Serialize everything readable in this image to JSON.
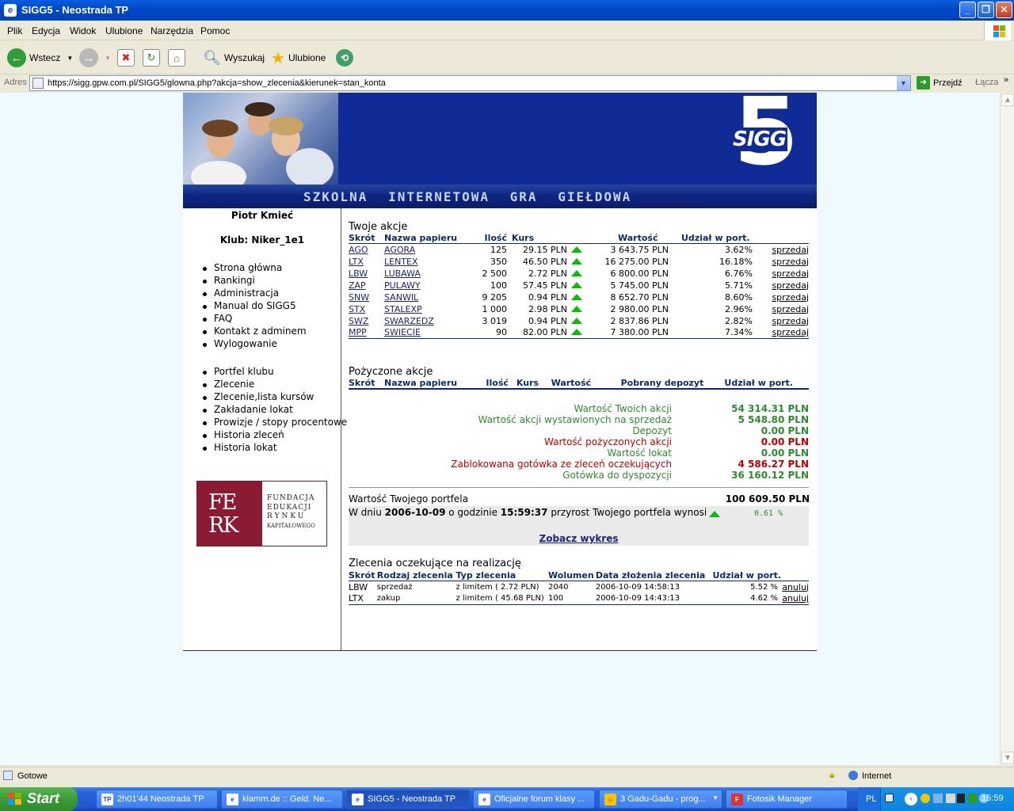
{
  "window": {
    "title": "SIGG5 - Neostrada TP"
  },
  "menu": [
    "Plik",
    "Edycja",
    "Widok",
    "Ulubione",
    "Narzędzia",
    "Pomoc"
  ],
  "toolbar": {
    "back": "Wstecz",
    "search": "Wyszukaj",
    "favorites": "Ulubione"
  },
  "address": {
    "label": "Adres",
    "url": "https://sigg.gpw.com.pl/SIGG5/glowna.php?akcja=show_zlecenia&kierunek=stan_konta",
    "go": "Przejdź",
    "links": "Łącza"
  },
  "banner": {
    "tagline": "SZKOLNA INTERNETOWA GRA GIEŁDOWA",
    "logo_text": "SIGG",
    "logo_number": "5"
  },
  "sidebar": {
    "user": "Piotr Kmieć",
    "club": "Klub: Niker_1e1",
    "menu1": [
      "Strona główna",
      "Rankingi",
      "Administracja",
      "Manual do SIGG5",
      "FAQ",
      "Kontakt z adminem",
      "Wylogowanie"
    ],
    "menu2": [
      "Portfel klubu",
      "Zlecenie",
      "Zlecenie,lista kursów",
      "Zakładanie lokat",
      "Prowizje / stopy procentowe",
      "Historia zleceń",
      "Historia lokat"
    ],
    "ferk": {
      "letters1": "FE",
      "letters2": "RK",
      "text": [
        "FUNDACJA",
        "EDUKACJI",
        "RYNKU",
        "KAPITAŁOWEGO"
      ]
    }
  },
  "stocks": {
    "title": "Twoje akcje",
    "headers": [
      "Skrót",
      "Nazwa papieru",
      "Ilość",
      "Kurs",
      "",
      "Wartość",
      "Udział w port.",
      ""
    ],
    "rows": [
      [
        "AGO",
        "AGORA",
        "125",
        "29.15 PLN",
        "3 643.75 PLN",
        "3.62%",
        "sprzedaj"
      ],
      [
        "LTX",
        "LENTEX",
        "350",
        "46.50 PLN",
        "16 275.00 PLN",
        "16.18%",
        "sprzedaj"
      ],
      [
        "LBW",
        "LUBAWA",
        "2 500",
        "2.72 PLN",
        "6 800.00 PLN",
        "6.76%",
        "sprzedaj"
      ],
      [
        "ZAP",
        "PULAWY",
        "100",
        "57.45 PLN",
        "5 745.00 PLN",
        "5.71%",
        "sprzedaj"
      ],
      [
        "SNW",
        "SANWIL",
        "9 205",
        "0.94 PLN",
        "8 652.70 PLN",
        "8.60%",
        "sprzedaj"
      ],
      [
        "STX",
        "STALEXP",
        "1 000",
        "2.98 PLN",
        "2 980.00 PLN",
        "2.96%",
        "sprzedaj"
      ],
      [
        "SWZ",
        "SWARZEDZ",
        "3 019",
        "0.94 PLN",
        "2 837.86 PLN",
        "2.82%",
        "sprzedaj"
      ],
      [
        "MPP",
        "SWIECIE",
        "90",
        "82.00 PLN",
        "7 380.00 PLN",
        "7.34%",
        "sprzedaj"
      ]
    ]
  },
  "borrowed": {
    "title": "Pożyczone akcje",
    "headers": [
      "Skrót",
      "Nazwa papieru",
      "Ilość",
      "Kurs",
      "Wartość",
      "Pobrany depozyt",
      "Udział w port."
    ]
  },
  "summary": [
    {
      "label": "Wartość Twoich akcji",
      "value": "54 314.31 PLN",
      "color": "#2e8b2e"
    },
    {
      "label": "Wartość akcji wystawionych na sprzedaż",
      "value": "5 548.80 PLN",
      "color": "#2e8b2e"
    },
    {
      "label": "Depozyt",
      "value": "0.00 PLN",
      "color": "#2e8b2e"
    },
    {
      "label": "Wartość pożyczonych akcji",
      "value": "0.00 PLN",
      "color": "#c00000"
    },
    {
      "label": "Wartość lokat",
      "value": "0.00 PLN",
      "color": "#2e8b2e"
    },
    {
      "label": "Zablokowana gotówka ze zleceń oczekujących",
      "value": "4 586.27 PLN",
      "color": "#c00000"
    },
    {
      "label": "Gotówka do dyspozycji",
      "value": "36 160.12 PLN",
      "color": "#2e8b2e"
    }
  ],
  "portfolio": {
    "label": "Wartość Twojego portfela",
    "value": "100 609.50 PLN",
    "growth_prefix": "W dniu",
    "date": "2006-10-09",
    "time_prefix": "o godzinie",
    "time": "15:59:37",
    "growth_suffix": "przyrost Twojego portfela wynosi",
    "growth": "0.61 %",
    "chart_link": "Zobacz wykres"
  },
  "orders": {
    "title": "Zlecenia oczekujące na realizację",
    "headers": [
      "Skrót",
      "Rodzaj zlecenia",
      "Typ zlecenia",
      "Wolumen",
      "Data złożenia zlecenia",
      "Udział w port.",
      ""
    ],
    "rows": [
      [
        "LBW",
        "sprzedaż",
        "z limitem ( 2.72 PLN)",
        "2040",
        "2006-10-09 14:58:13",
        "5.52 %",
        "anuluj"
      ],
      [
        "LTX",
        "zakup",
        "z limitem ( 45.68 PLN)",
        "100",
        "2006-10-09 14:43:13",
        "4.62 %",
        "anuluj"
      ]
    ]
  },
  "status": {
    "text": "Gotowe",
    "zone": "Internet"
  },
  "taskbar": {
    "start": "Start",
    "tasks": [
      "2h01'44 Neostrada TP",
      "klamm.de :: Geld. Ne...",
      "SIGG5 - Neostrada TP",
      "Oficjalne forum klasy ...",
      "3 Gadu-Gadu - prog...",
      "Fotosik Manager"
    ],
    "lang": "PL",
    "clock": "15:59"
  }
}
